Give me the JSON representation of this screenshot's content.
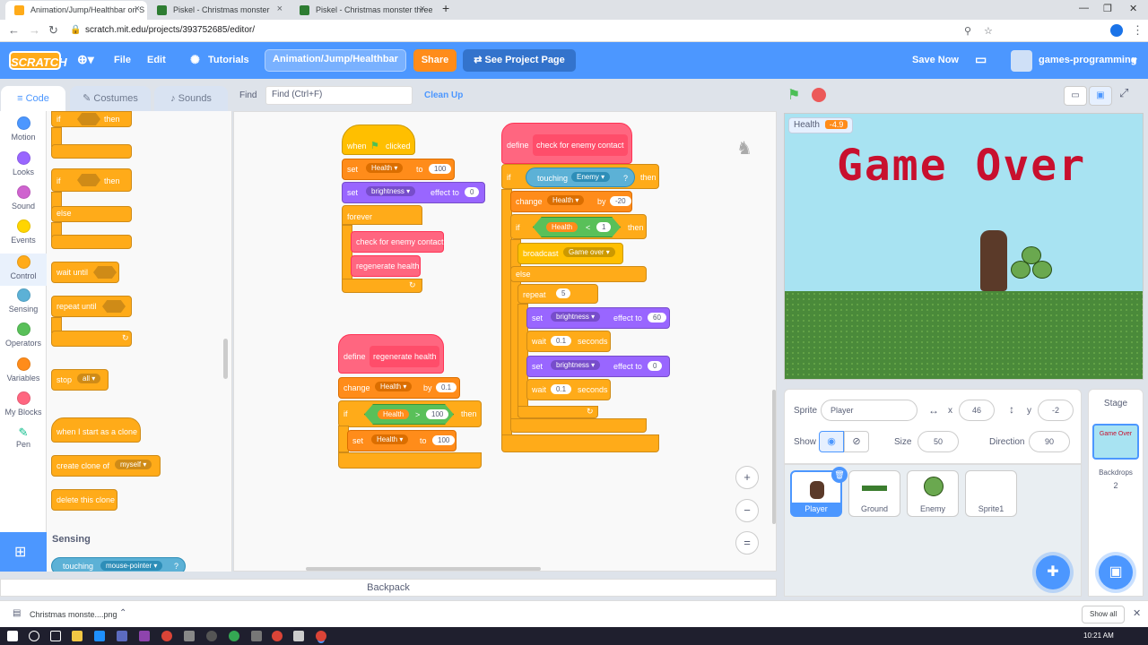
{
  "browser": {
    "tabs": [
      {
        "title": "Animation/Jump/Healthbar on S"
      },
      {
        "title": "Piskel - Christmas monster"
      },
      {
        "title": "Piskel - Christmas monster three"
      }
    ],
    "url": "scratch.mit.edu/projects/393752685/editor/"
  },
  "menubar": {
    "logo": "SCRATCH",
    "file": "File",
    "edit": "Edit",
    "tutorials": "Tutorials",
    "project_title": "Animation/Jump/Healthbar",
    "share": "Share",
    "see_project": "See Project Page",
    "save_now": "Save Now",
    "user": "games-programming"
  },
  "tabs": {
    "code": "Code",
    "costumes": "Costumes",
    "sounds": "Sounds"
  },
  "toolbar": {
    "find_label": "Find",
    "find_placeholder": "Find (Ctrl+F)",
    "cleanup": "Clean Up"
  },
  "categories": [
    {
      "label": "Motion",
      "color": "#4c97ff"
    },
    {
      "label": "Looks",
      "color": "#9966ff"
    },
    {
      "label": "Sound",
      "color": "#cf63cf"
    },
    {
      "label": "Events",
      "color": "#ffd500"
    },
    {
      "label": "Control",
      "color": "#ffab19"
    },
    {
      "label": "Sensing",
      "color": "#5cb1d6"
    },
    {
      "label": "Operators",
      "color": "#59c059"
    },
    {
      "label": "Variables",
      "color": "#ff8c1a"
    },
    {
      "label": "My Blocks",
      "color": "#ff6680"
    },
    {
      "label": "Pen",
      "color": "#0fbd8c"
    }
  ],
  "palette": {
    "if": "if",
    "then": "then",
    "else": "else",
    "wait_until": "wait until",
    "repeat_until": "repeat until",
    "stop": "stop",
    "stop_opt": "all",
    "when_clone": "when I start as a clone",
    "create_clone": "create clone of",
    "create_clone_opt": "myself",
    "delete_clone": "delete this clone",
    "sensing_header": "Sensing",
    "touching": "touching",
    "touching_opt": "mouse-pointer",
    "q": "?"
  },
  "script1": {
    "hat": "when",
    "hat2": "clicked",
    "set": "set",
    "var": "Health",
    "to": "to",
    "val": "100",
    "set2": "set",
    "effect": "brightness",
    "effect_to": "effect to",
    "effect_val": "0",
    "forever": "forever",
    "call1": "check for enemy contact",
    "call2": "regenerate health"
  },
  "script2": {
    "define": "define",
    "name": "regenerate health",
    "change": "change",
    "var": "Health",
    "by": "by",
    "byval": "0.1",
    "if": "if",
    "cmp_var": "Health",
    "gt": ">",
    "cmp_val": "100",
    "then": "then",
    "set": "set",
    "set_var": "Health",
    "to": "to",
    "set_val": "100"
  },
  "script3": {
    "define": "define",
    "name": "check for enemy contact",
    "if": "if",
    "touching": "touching",
    "enemy": "Enemy",
    "q": "?",
    "then": "then",
    "change": "change",
    "var": "Health",
    "by": "by",
    "byval": "-20",
    "if2": "if",
    "cmp_var": "Health",
    "lt": "<",
    "cmp_val": "1",
    "then2": "then",
    "broadcast": "broadcast",
    "msg": "Game over",
    "else": "else",
    "repeat": "repeat",
    "repeat_val": "5",
    "set": "set",
    "effect": "brightness",
    "effect_to": "effect to",
    "eff1": "60",
    "wait": "wait",
    "wait1": "0.1",
    "seconds": "seconds",
    "eff2": "0",
    "wait2": "0.1"
  },
  "stage": {
    "monitor_label": "Health",
    "monitor_value": "-4.9",
    "text": "Game Over"
  },
  "sprite_info": {
    "sprite_label": "Sprite",
    "sprite_name": "Player",
    "x_label": "x",
    "x": "46",
    "y_label": "y",
    "y": "-2",
    "show_label": "Show",
    "size_label": "Size",
    "size": "50",
    "direction_label": "Direction",
    "direction": "90"
  },
  "sprites": [
    {
      "name": "Player"
    },
    {
      "name": "Ground"
    },
    {
      "name": "Enemy"
    },
    {
      "name": "Sprite1"
    }
  ],
  "stage_panel": {
    "label": "Stage",
    "thumb": "Game Over",
    "backdrops_label": "Backdrops",
    "backdrops": "2"
  },
  "backpack": "Backpack",
  "download": {
    "file": "Christmas monste....png",
    "show_all": "Show all"
  },
  "taskbar": {
    "time": "10:21 AM"
  }
}
